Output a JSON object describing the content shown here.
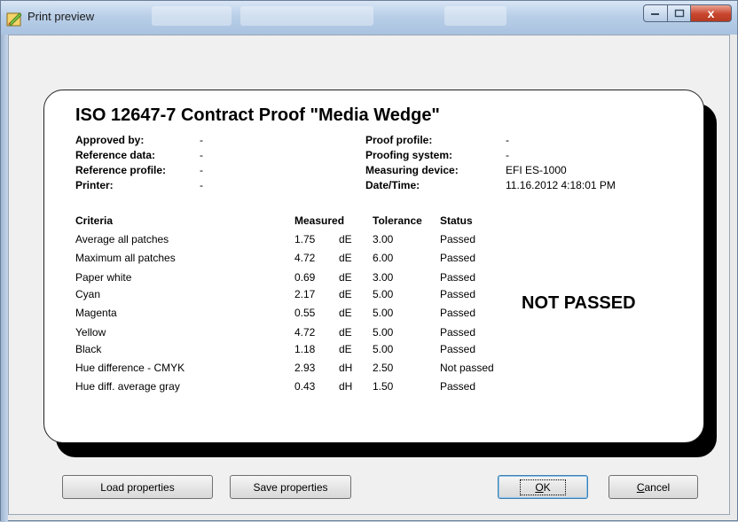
{
  "window": {
    "title": "Print preview",
    "controls": {
      "minimize": "–",
      "maximize": "□",
      "close": "x"
    }
  },
  "report": {
    "title": "ISO 12647-7 Contract Proof \"Media Wedge\"",
    "info_left": [
      {
        "label": "Approved by:",
        "value": "-"
      },
      {
        "label": "Reference data:",
        "value": "-"
      },
      {
        "label": "Reference profile:",
        "value": "-"
      },
      {
        "label": "Printer:",
        "value": "-"
      }
    ],
    "info_right": [
      {
        "label": "Proof profile:",
        "value": "-"
      },
      {
        "label": "Proofing system:",
        "value": "-"
      },
      {
        "label": "Measuring device:",
        "value": "EFI ES-1000"
      },
      {
        "label": "Date/Time:",
        "value": "11.16.2012 4:18:01 PM"
      }
    ],
    "headers": {
      "criteria": "Criteria",
      "measured": "Measured",
      "tolerance": "Tolerance",
      "status": "Status"
    },
    "rows": [
      {
        "criteria": "Average all patches",
        "measured": "1.75",
        "unit": "dE",
        "tolerance": "3.00",
        "status": "Passed"
      },
      {
        "criteria": "Maximum all patches",
        "measured": "4.72",
        "unit": "dE",
        "tolerance": "6.00",
        "status": "Passed"
      },
      {
        "criteria": "Paper white",
        "measured": "0.69",
        "unit": "dE",
        "tolerance": "3.00",
        "status": "Passed"
      },
      {
        "criteria": "Cyan",
        "measured": "2.17",
        "unit": "dE",
        "tolerance": "5.00",
        "status": "Passed"
      },
      {
        "criteria": "Magenta",
        "measured": "0.55",
        "unit": "dE",
        "tolerance": "5.00",
        "status": "Passed"
      },
      {
        "criteria": "Yellow",
        "measured": "4.72",
        "unit": "dE",
        "tolerance": "5.00",
        "status": "Passed"
      },
      {
        "criteria": "Black",
        "measured": "1.18",
        "unit": "dE",
        "tolerance": "5.00",
        "status": "Passed"
      },
      {
        "criteria": "Hue difference - CMYK",
        "measured": "2.93",
        "unit": "dH",
        "tolerance": "2.50",
        "status": "Not passed"
      },
      {
        "criteria": "Hue diff. average gray",
        "measured": "0.43",
        "unit": "dH",
        "tolerance": "1.50",
        "status": "Passed"
      }
    ],
    "verdict": "NOT PASSED"
  },
  "buttons": {
    "load": "Load properties",
    "save": "Save properties",
    "ok_accel": "O",
    "ok_rest": "K",
    "cancel_accel": "C",
    "cancel_rest": "ancel"
  }
}
